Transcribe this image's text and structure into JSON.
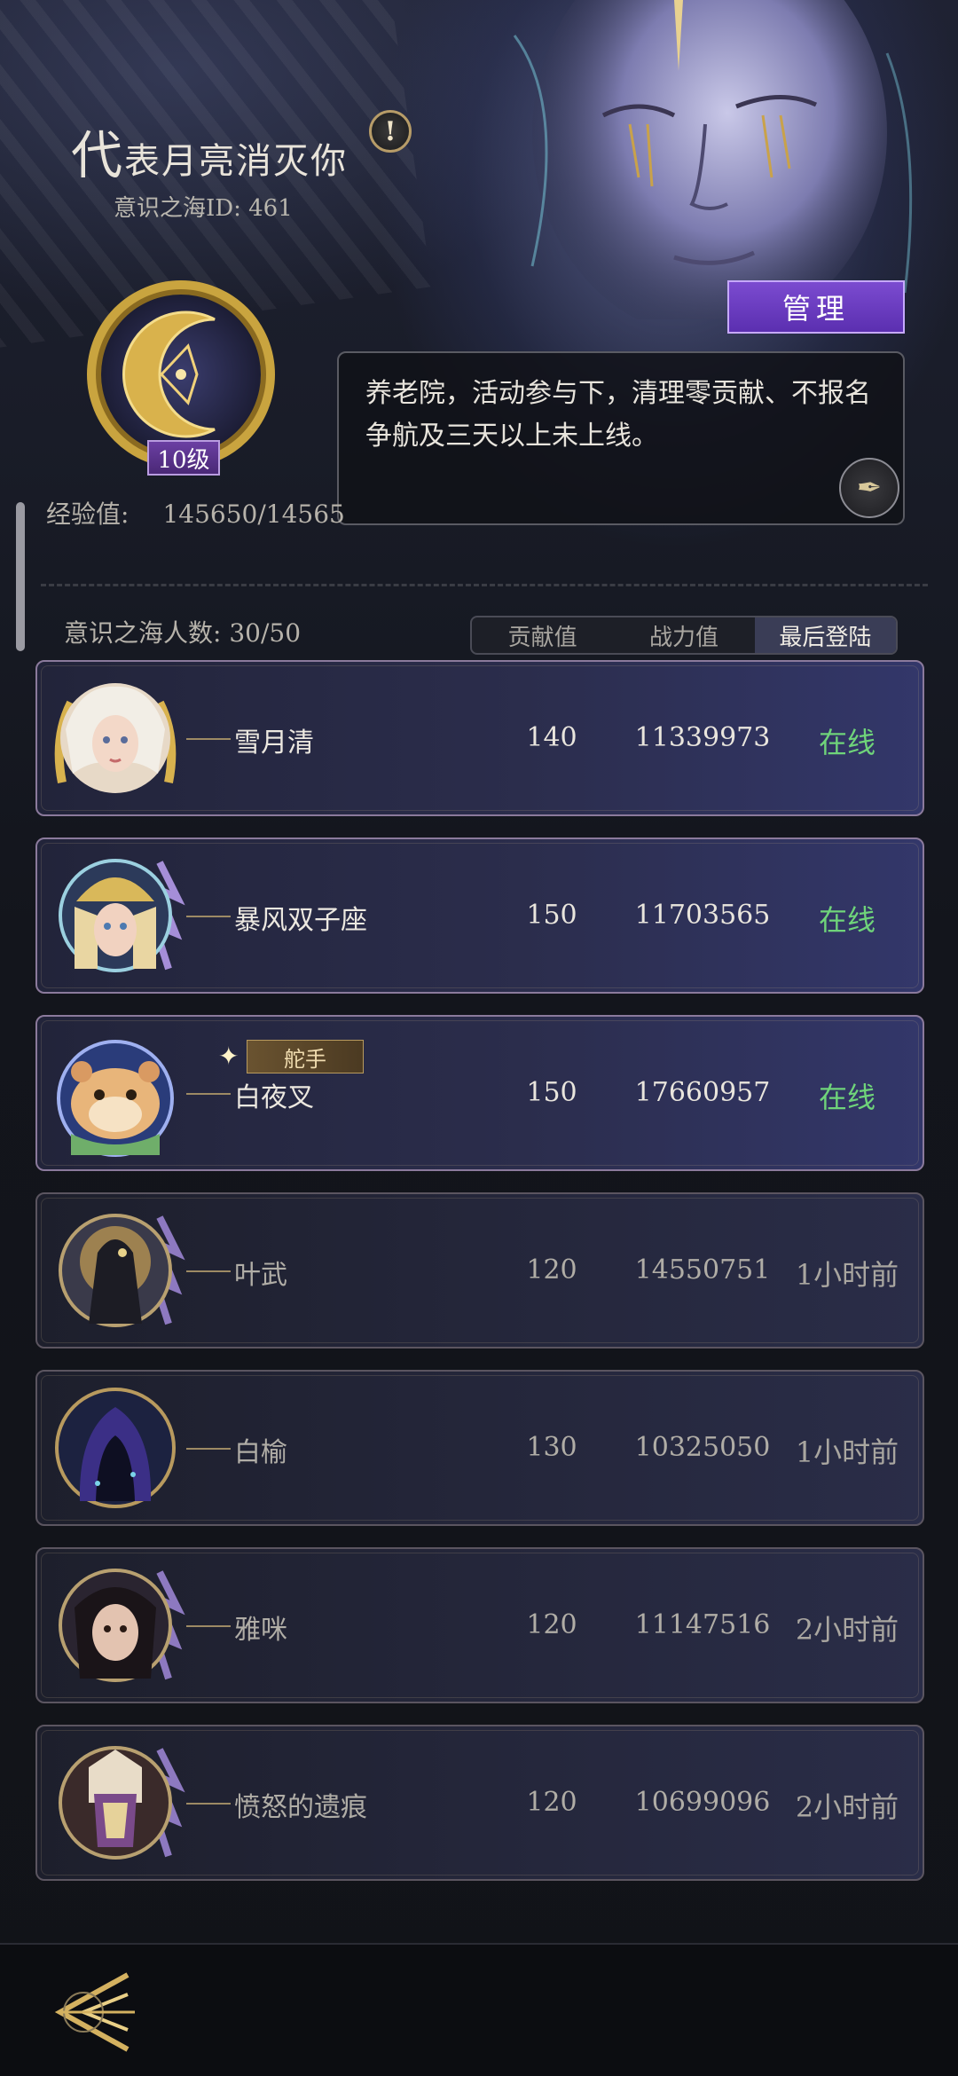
{
  "guild": {
    "title_first": "代",
    "title_rest": "表月亮消灭你",
    "id_label": "意识之海ID: 461",
    "level": "10级",
    "manage_label": "管理",
    "notice": "养老院，活动参与下，清理零贡献、不报名争航及三天以上未上线。",
    "exp_label": "经验值:",
    "exp_value": "145650/14565",
    "member_count": "意识之海人数: 30/50"
  },
  "tabs": [
    {
      "label": "贡献值",
      "active": false
    },
    {
      "label": "战力值",
      "active": false
    },
    {
      "label": "最后登陆",
      "active": true
    }
  ],
  "members": [
    {
      "name": "雪月清",
      "contribution": "140",
      "power": "11339973",
      "status": "在线",
      "online": true,
      "tag": ""
    },
    {
      "name": "暴风双子座",
      "contribution": "150",
      "power": "11703565",
      "status": "在线",
      "online": true,
      "tag": ""
    },
    {
      "name": "白夜叉",
      "contribution": "150",
      "power": "17660957",
      "status": "在线",
      "online": true,
      "tag": "舵手"
    },
    {
      "name": "叶武",
      "contribution": "120",
      "power": "14550751",
      "status": "1小时前",
      "online": false,
      "tag": ""
    },
    {
      "name": "白榆",
      "contribution": "130",
      "power": "10325050",
      "status": "1小时前",
      "online": false,
      "tag": ""
    },
    {
      "name": "雅咪",
      "contribution": "120",
      "power": "11147516",
      "status": "2小时前",
      "online": false,
      "tag": ""
    },
    {
      "name": "愤怒的遗痕",
      "contribution": "120",
      "power": "10699096",
      "status": "2小时前",
      "online": false,
      "tag": ""
    }
  ],
  "icons": {
    "alert": "exclamation-icon",
    "feather": "quill-icon",
    "back": "back-arrow-icon"
  },
  "colors": {
    "online": "#6fd47a",
    "manage": "#6a3cc4",
    "level_badge": "#5a3290"
  }
}
